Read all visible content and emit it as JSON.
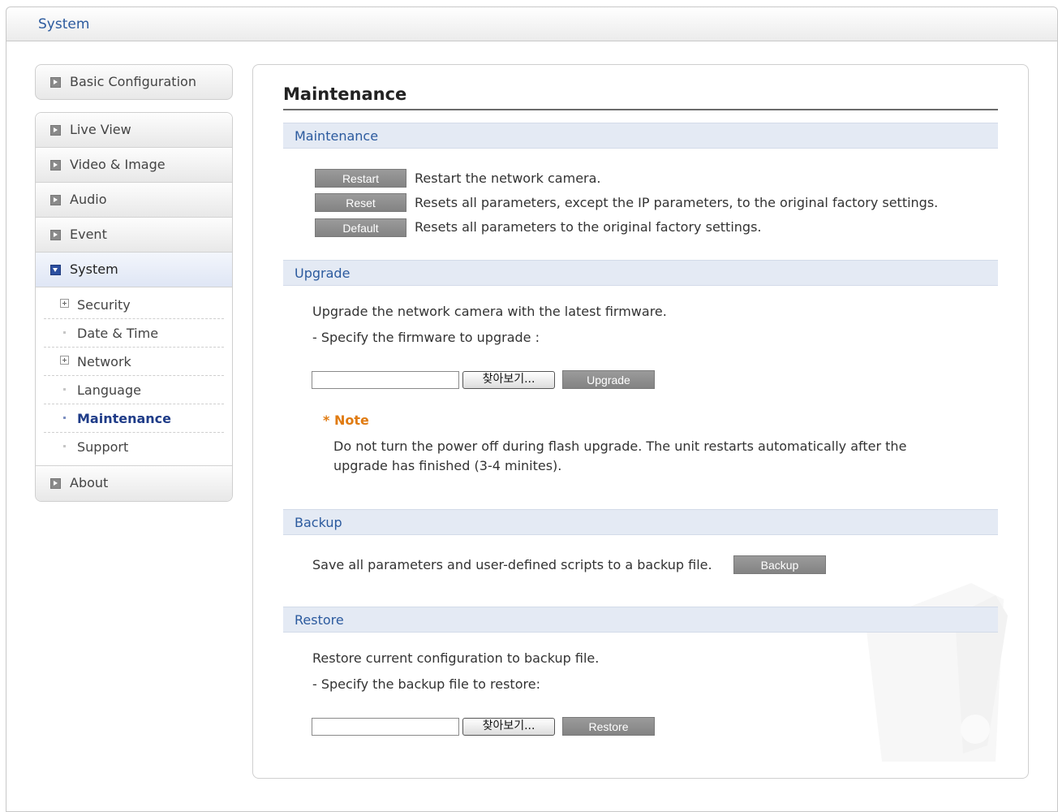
{
  "header": {
    "title": "System"
  },
  "sidebar": {
    "basic": "Basic Configuration",
    "items": [
      {
        "label": "Live View"
      },
      {
        "label": "Video & Image"
      },
      {
        "label": "Audio"
      },
      {
        "label": "Event"
      },
      {
        "label": "System"
      }
    ],
    "system_sub": [
      {
        "label": "Security"
      },
      {
        "label": "Date & Time"
      },
      {
        "label": "Network"
      },
      {
        "label": "Language"
      },
      {
        "label": "Maintenance"
      },
      {
        "label": "Support"
      }
    ],
    "about": "About"
  },
  "main": {
    "title": "Maintenance",
    "maintenance": {
      "heading": "Maintenance",
      "restart_btn": "Restart",
      "restart_desc": "Restart the network camera.",
      "reset_btn": "Reset",
      "reset_desc": "Resets all parameters, except the IP parameters, to the original factory settings.",
      "default_btn": "Default",
      "default_desc": "Resets all parameters to the original factory settings."
    },
    "upgrade": {
      "heading": "Upgrade",
      "line1": "Upgrade the network camera with the latest firmware.",
      "line2": "- Specify the firmware to upgrade :",
      "file_value": "",
      "browse_btn": "찾아보기...",
      "upgrade_btn": "Upgrade",
      "note_title": "* Note",
      "note_line1": "Do not turn the power off during flash upgrade. The unit restarts automatically after the",
      "note_line2": "upgrade has finished (3-4 minites)."
    },
    "backup": {
      "heading": "Backup",
      "desc": "Save all parameters and user-defined scripts to a backup file.",
      "backup_btn": "Backup"
    },
    "restore": {
      "heading": "Restore",
      "line1": "Restore current configuration to backup file.",
      "line2": "- Specify the backup file to restore:",
      "file_value": "",
      "browse_btn": "찾아보기...",
      "restore_btn": "Restore"
    }
  }
}
